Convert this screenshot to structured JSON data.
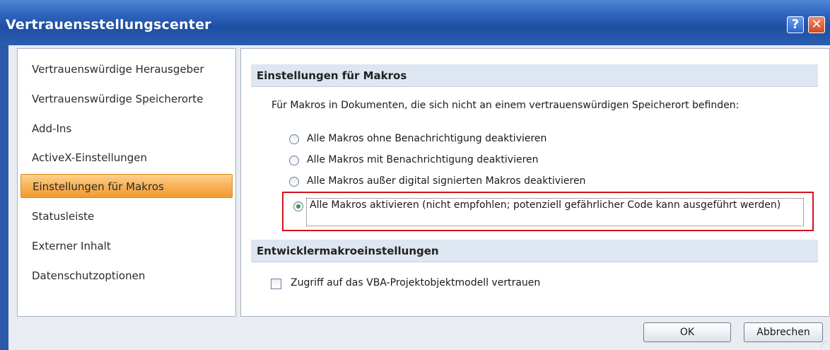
{
  "window": {
    "title": "Vertrauensstellungscenter",
    "help_label": "?",
    "close_label": "✕"
  },
  "nav": {
    "items": [
      {
        "label": "Vertrauenswürdige Herausgeber"
      },
      {
        "label": "Vertrauenswürdige Speicherorte"
      },
      {
        "label": "Add-Ins"
      },
      {
        "label": "ActiveX-Einstellungen"
      },
      {
        "label": "Einstellungen für Makros",
        "selected": true
      },
      {
        "label": "Statusleiste"
      },
      {
        "label": "Externer Inhalt"
      },
      {
        "label": "Datenschutzoptionen"
      }
    ]
  },
  "macro_settings": {
    "header": "Einstellungen für Makros",
    "description": "Für Makros in Dokumenten, die sich nicht an einem vertrauenswürdigen Speicherort befinden:",
    "options": [
      {
        "label": "Alle Makros ohne Benachrichtigung deaktivieren",
        "checked": false
      },
      {
        "label": "Alle Makros mit Benachrichtigung deaktivieren",
        "checked": false
      },
      {
        "label": "Alle Makros außer digital signierten Makros deaktivieren",
        "checked": false
      },
      {
        "label": "Alle Makros aktivieren (nicht empfohlen; potenziell gefährlicher Code kann ausgeführt werden)",
        "checked": true
      }
    ]
  },
  "developer_settings": {
    "header": "Entwicklermakroeinstellungen",
    "vba_checkbox_label": "Zugriff auf das VBA-Projektobjektmodell vertrauen",
    "vba_checked": false
  },
  "buttons": {
    "ok": "OK",
    "cancel": "Abbrechen"
  },
  "colors": {
    "highlight_border": "#d4131c",
    "selected_nav": "#f8b35a",
    "titlebar": "#2d62bc"
  }
}
